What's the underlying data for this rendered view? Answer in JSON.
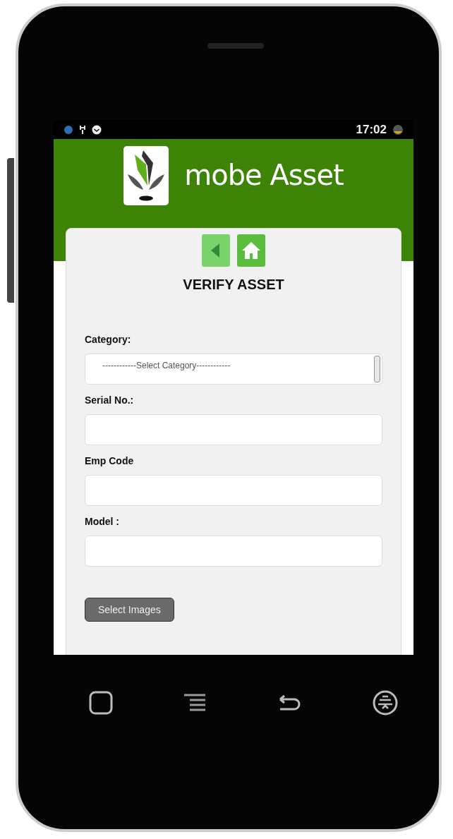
{
  "status_bar": {
    "time": "17:02"
  },
  "header": {
    "app_name": "mobe Asset"
  },
  "page_title": "VERIFY ASSET",
  "fields": [
    {
      "kind": "select",
      "label": "Category:",
      "selected_option": "------------Select Category------------"
    },
    {
      "kind": "text",
      "label": "Serial No.:"
    },
    {
      "kind": "text",
      "label": "Emp Code"
    },
    {
      "kind": "text",
      "label": "Model :"
    }
  ],
  "buttons": [
    "Select Images"
  ]
}
